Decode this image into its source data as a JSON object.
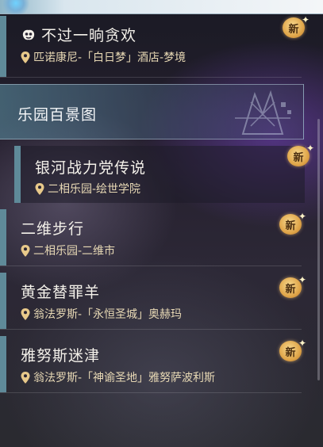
{
  "quests": [
    {
      "title": "不过一晌贪欢",
      "location": "匹诺康尼-「白日梦」酒店-梦境",
      "badge": "新"
    },
    {
      "title": "银河战力党传说",
      "location": "二相乐园-绘世学院",
      "badge": "新"
    },
    {
      "title": "二维步行",
      "location": "二相乐园-二维市",
      "badge": "新"
    },
    {
      "title": "黄金替罪羊",
      "location": "翁法罗斯-「永恒圣城」奥赫玛",
      "badge": "新"
    },
    {
      "title": "雅努斯迷津",
      "location": "翁法罗斯-「神谕圣地」雅努萨波利斯",
      "badge": "新"
    }
  ],
  "section": {
    "title": "乐园百景图"
  },
  "colors": {
    "accent_bar": "#5f8a99",
    "location_text": "#e8d9b5",
    "badge_gold": "#e0a64a"
  },
  "icons": {
    "quest_type": "mask-icon",
    "location": "map-pin-icon",
    "new_badge": "new-badge-icon"
  }
}
